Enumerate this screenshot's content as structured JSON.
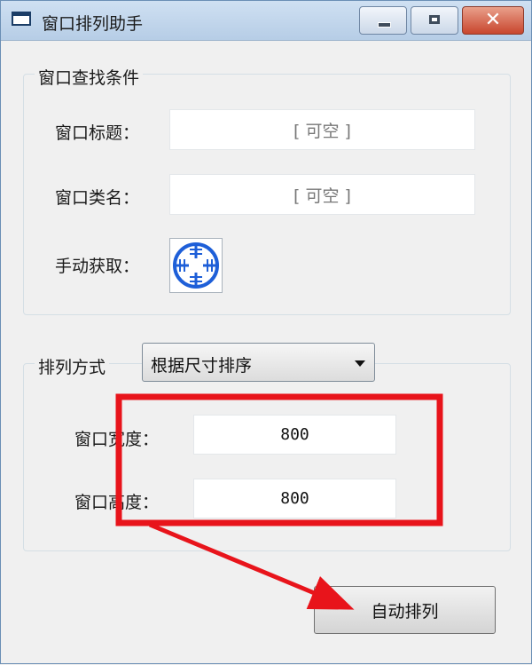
{
  "window": {
    "title": "窗口排列助手",
    "controls": {
      "minimize": "minimize",
      "maximize": "maximize",
      "close": "✕"
    }
  },
  "find_group": {
    "legend": "窗口查找条件",
    "title_label": "窗口标题：",
    "title_placeholder": "[ 可空 ]",
    "class_label": "窗口类名：",
    "class_placeholder": "[ 可空 ]",
    "manual_label": "手动获取："
  },
  "arrange_group": {
    "legend": "排列方式",
    "mode_selected": "根据尺寸排序",
    "width_label": "窗口宽度：",
    "width_value": "800",
    "height_label": "窗口高度：",
    "height_value": "800"
  },
  "actions": {
    "auto_arrange": "自动排列"
  },
  "colors": {
    "accent_blue": "#1e5fd8",
    "highlight_red": "#e8141b",
    "titlebar": "#c3d6ec"
  },
  "icons": {
    "app": "window-app-icon",
    "picker": "crosshair-target-icon",
    "dropdown": "triangle-down-icon"
  }
}
